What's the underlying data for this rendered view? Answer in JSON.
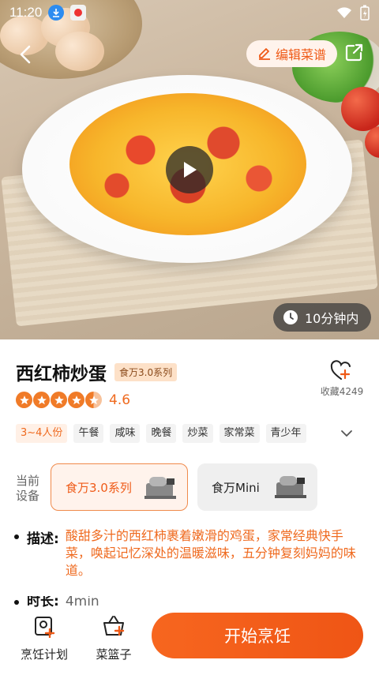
{
  "status_bar": {
    "time": "11:20"
  },
  "hero": {
    "edit_label": "编辑菜谱",
    "time_badge": "10分钟内"
  },
  "recipe": {
    "title": "西红柿炒蛋",
    "series_badge": "食万3.0系列",
    "favorites_label": "收藏4249",
    "rating": 4.6,
    "rating_text": "4.6",
    "tags": [
      "3~4人份",
      "午餐",
      "咸味",
      "晚餐",
      "炒菜",
      "家常菜",
      "青少年"
    ]
  },
  "device": {
    "label": "当前设备",
    "options": [
      {
        "name": "食万3.0系列",
        "active": true
      },
      {
        "name": "食万Mini",
        "active": false
      }
    ]
  },
  "description": {
    "label": "描述:",
    "text": "酸甜多汁的西红柿裹着嫩滑的鸡蛋，家常经典快手菜，唤起记忆深处的温暖滋味，五分钟复刻妈妈的味道。"
  },
  "duration": {
    "label": "时长:",
    "value": "4min"
  },
  "bottom_bar": {
    "plan_label": "烹饪计划",
    "basket_label": "菜篮子",
    "start_label": "开始烹饪"
  },
  "colors": {
    "accent": "#EF5A17",
    "accent_light": "#FFF3EC"
  },
  "icons": [
    "back-arrow-icon",
    "edit-pencil-icon",
    "share-icon",
    "play-icon",
    "clock-icon",
    "heart-plus-icon",
    "star-icon",
    "chevron-down-icon",
    "plan-add-icon",
    "basket-add-icon"
  ]
}
